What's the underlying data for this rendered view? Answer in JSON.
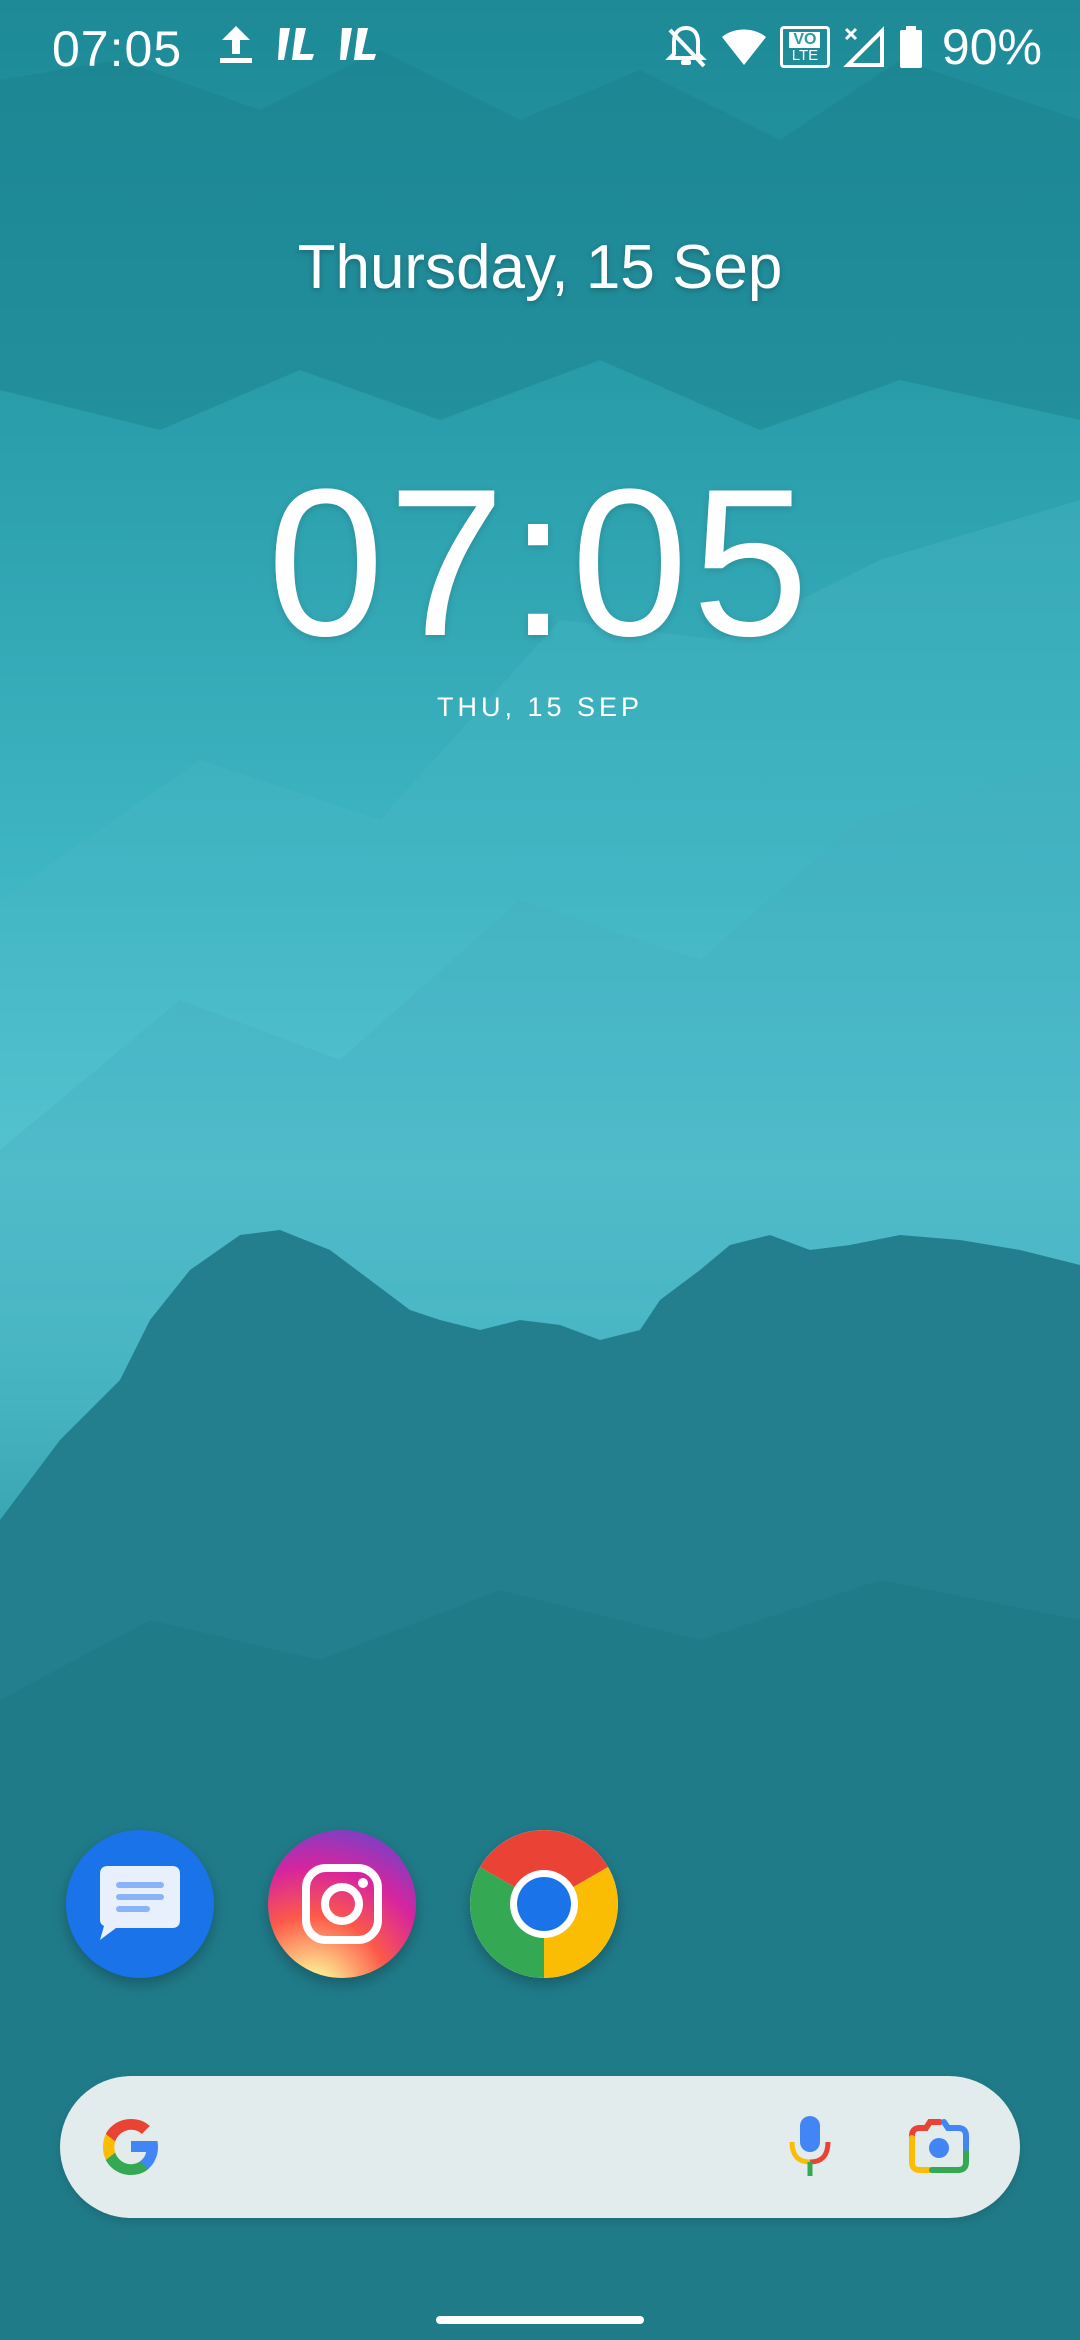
{
  "status_bar": {
    "time": "07:05",
    "battery": "90%",
    "volte_label_top": "VO",
    "volte_label_bottom": "LTE",
    "icons": [
      "upload-icon",
      "network-speed-icon",
      "network-speed-icon",
      "notifications-off-icon",
      "wifi-icon",
      "volte-icon",
      "signal-icon",
      "battery-icon"
    ]
  },
  "widget": {
    "date_large": "Thursday, 15 Sep",
    "clock": "07:05",
    "date_small": "THU, 15 SEP"
  },
  "apps": [
    {
      "name": "Messages",
      "icon": "messages-icon"
    },
    {
      "name": "Instagram",
      "icon": "instagram-icon"
    },
    {
      "name": "Chrome",
      "icon": "chrome-icon"
    }
  ],
  "search": {
    "icons": [
      "google-g-icon",
      "microphone-icon",
      "google-lens-icon"
    ]
  },
  "colors": {
    "wallpaper_top": "#1d8a96",
    "wallpaper_mid": "#5cc9d6",
    "wallpaper_bottom": "#258896",
    "search_bar_bg": "#e3eced",
    "messages_blue": "#1a73e8"
  }
}
